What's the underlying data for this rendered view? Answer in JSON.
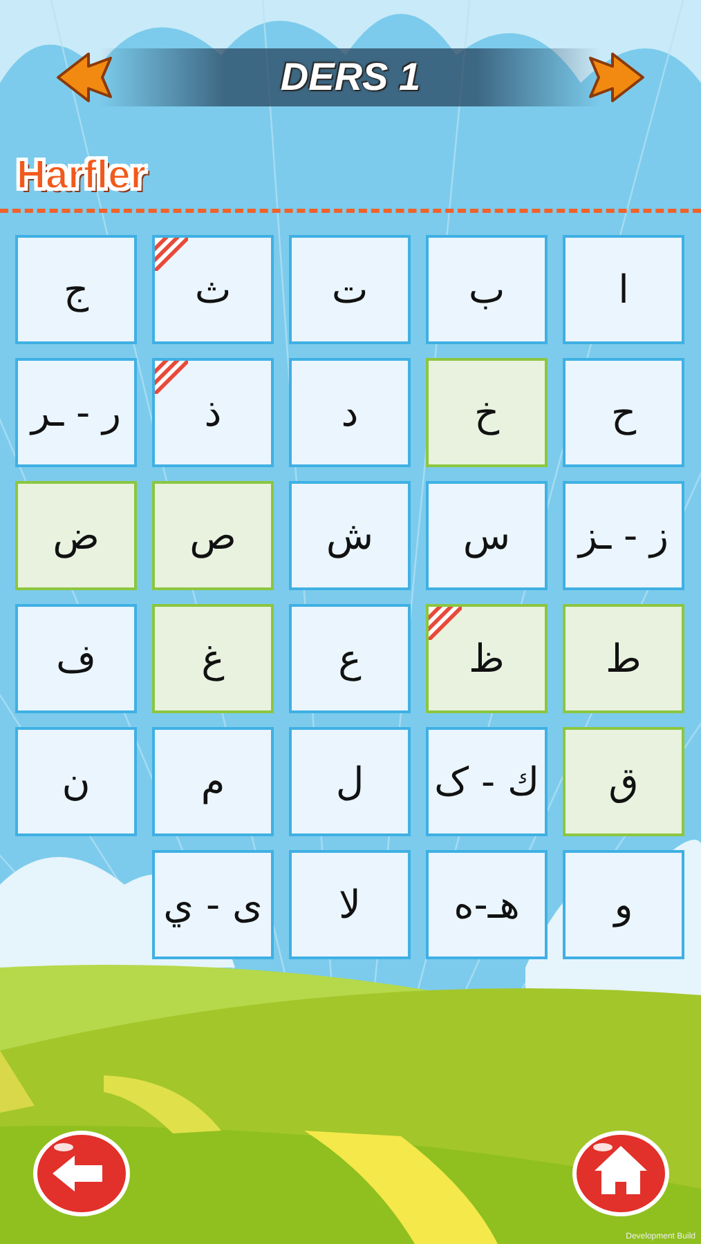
{
  "header": {
    "title": "DERS 1"
  },
  "section": {
    "title": "Harfler"
  },
  "tiles": [
    {
      "letter": "ا",
      "learned": false,
      "marked": false
    },
    {
      "letter": "ب",
      "learned": false,
      "marked": false
    },
    {
      "letter": "ت",
      "learned": false,
      "marked": false
    },
    {
      "letter": "ث",
      "learned": false,
      "marked": true
    },
    {
      "letter": "ج",
      "learned": false,
      "marked": false
    },
    {
      "letter": "ح",
      "learned": false,
      "marked": false
    },
    {
      "letter": "خ",
      "learned": true,
      "marked": false
    },
    {
      "letter": "د",
      "learned": false,
      "marked": false
    },
    {
      "letter": "ذ",
      "learned": false,
      "marked": true
    },
    {
      "letter": "ر - ـر",
      "learned": false,
      "marked": false
    },
    {
      "letter": "ز - ـز",
      "learned": false,
      "marked": false
    },
    {
      "letter": "س",
      "learned": false,
      "marked": false
    },
    {
      "letter": "ش",
      "learned": false,
      "marked": false
    },
    {
      "letter": "ص",
      "learned": true,
      "marked": false
    },
    {
      "letter": "ض",
      "learned": true,
      "marked": false
    },
    {
      "letter": "ط",
      "learned": true,
      "marked": false
    },
    {
      "letter": "ظ",
      "learned": true,
      "marked": true
    },
    {
      "letter": "ع",
      "learned": false,
      "marked": false
    },
    {
      "letter": "غ",
      "learned": true,
      "marked": false
    },
    {
      "letter": "ف",
      "learned": false,
      "marked": false
    },
    {
      "letter": "ق",
      "learned": true,
      "marked": false
    },
    {
      "letter": "ك - ک",
      "learned": false,
      "marked": false
    },
    {
      "letter": "ل",
      "learned": false,
      "marked": false
    },
    {
      "letter": "م",
      "learned": false,
      "marked": false
    },
    {
      "letter": "ن",
      "learned": false,
      "marked": false
    },
    {
      "letter": "و",
      "learned": false,
      "marked": false
    },
    {
      "letter": "هـ-ه",
      "learned": false,
      "marked": false
    },
    {
      "letter": "لا",
      "learned": false,
      "marked": false
    },
    {
      "letter": "ى - ي",
      "learned": false,
      "marked": false
    }
  ],
  "footer": {
    "build_label": "Development Build"
  }
}
